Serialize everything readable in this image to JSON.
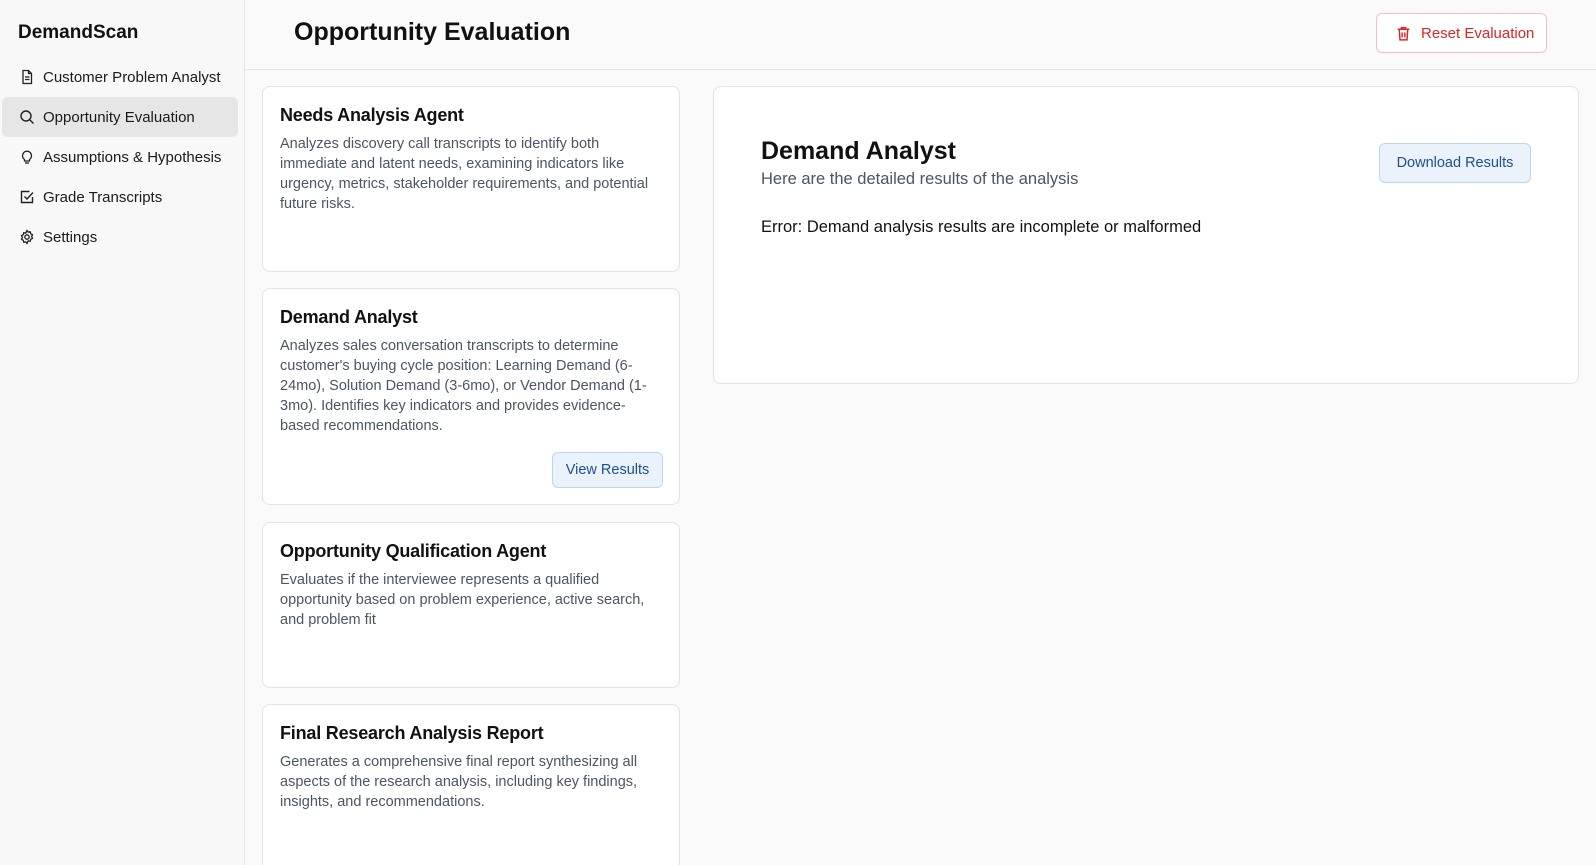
{
  "sidebar": {
    "brand": "DemandScan",
    "items": [
      {
        "label": "Customer Problem Analyst",
        "icon": "document-icon"
      },
      {
        "label": "Opportunity Evaluation",
        "icon": "search-icon",
        "active": true
      },
      {
        "label": "Assumptions & Hypothesis",
        "icon": "lightbulb-icon"
      },
      {
        "label": "Grade Transcripts",
        "icon": "check-square-icon"
      },
      {
        "label": "Settings",
        "icon": "gear-icon"
      }
    ]
  },
  "header": {
    "title": "Opportunity Evaluation",
    "reset_label": "Reset Evaluation",
    "reset_color": "#dc2626"
  },
  "agents": [
    {
      "title": "Needs Analysis Agent",
      "description": "Analyzes discovery call transcripts to identify both immediate and latent needs, examining indicators like urgency, metrics, stakeholder requirements, and potential future risks."
    },
    {
      "title": "Demand Analyst",
      "description": "Analyzes sales conversation transcripts to determine customer's buying cycle position: Learning Demand (6-24mo), Solution Demand (3-6mo), or Vendor Demand (1-3mo). Identifies key indicators and provides evidence-based recommendations.",
      "button_label": "View Results"
    },
    {
      "title": "Opportunity Qualification Agent",
      "description": "Evaluates if the interviewee represents a qualified opportunity based on problem experience, active search, and problem fit"
    },
    {
      "title": "Final Research Analysis Report",
      "description": "Generates a comprehensive final report synthesizing all aspects of the research analysis, including key findings, insights, and recommendations."
    }
  ],
  "result": {
    "title": "Demand Analyst",
    "subtitle": "Here are the detailed results of the analysis",
    "download_label": "Download Results",
    "message": "Error: Demand analysis results are incomplete or malformed"
  }
}
